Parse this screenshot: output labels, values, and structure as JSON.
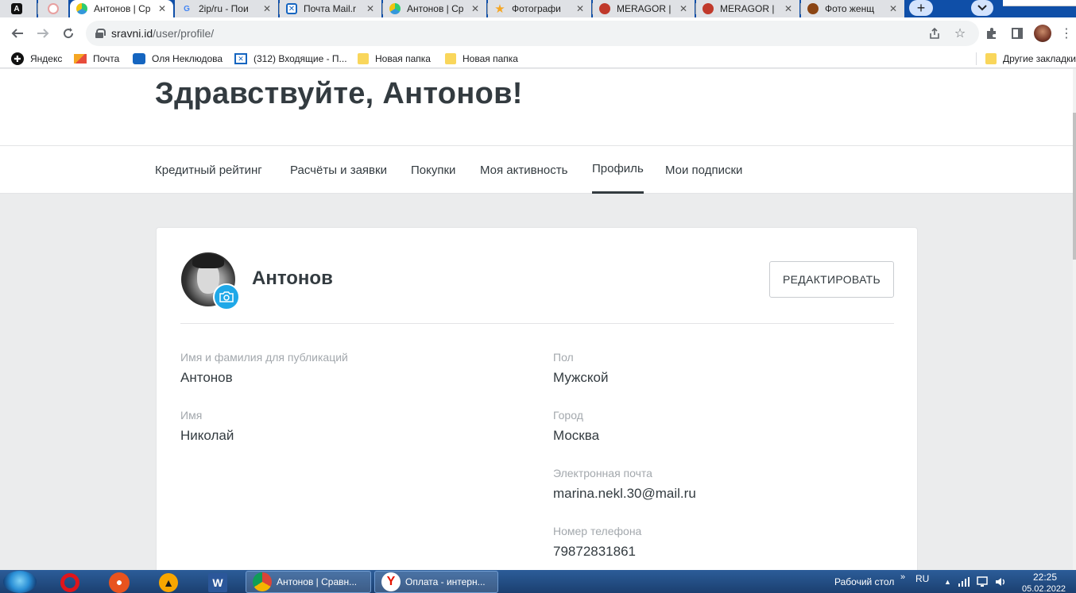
{
  "browser": {
    "tabs": [
      {
        "title": "",
        "icon": "A-logo-icon",
        "state": "inactive"
      },
      {
        "title": "",
        "icon": "red-circle-icon",
        "state": "inactive"
      },
      {
        "title": "Антонов | Ср",
        "icon": "sravni-icon",
        "state": "active"
      },
      {
        "title": "2ip/ru - Пои",
        "icon": "google-icon",
        "state": "inactive"
      },
      {
        "title": "Почта Mail.r",
        "icon": "mail-icon",
        "state": "inactive"
      },
      {
        "title": "Антонов | Ср",
        "icon": "sravni-icon",
        "state": "inactive"
      },
      {
        "title": "Фотографи",
        "icon": "star-icon",
        "state": "inactive"
      },
      {
        "title": "MERAGOR |",
        "icon": "meragor-icon",
        "state": "inactive"
      },
      {
        "title": "MERAGOR |",
        "icon": "meragor-icon",
        "state": "inactive"
      },
      {
        "title": "Фото женщ",
        "icon": "dog-icon",
        "state": "inactive"
      }
    ],
    "new_tab_label": "+",
    "url_domain": "sravni.id",
    "url_path": "/user/profile/",
    "bookmarks": [
      {
        "label": "Яндекс",
        "icon": "yandex-icon"
      },
      {
        "label": "Почта",
        "icon": "mail-envelope-icon"
      },
      {
        "label": "Оля Неклюдова",
        "icon": "chat-icon"
      },
      {
        "label": "(312) Входящие - П...",
        "icon": "mail-icon"
      },
      {
        "label": "Новая папка",
        "icon": "folder-icon"
      },
      {
        "label": "Новая папка",
        "icon": "folder-icon"
      }
    ],
    "other_bookmarks": "Другие закладки"
  },
  "page": {
    "greeting": "Здравствуйте, Антонов!",
    "nav": [
      {
        "label": "Кредитный рейтинг",
        "selected": false
      },
      {
        "label": "Расчёты и заявки",
        "selected": false
      },
      {
        "label": "Покупки",
        "selected": false
      },
      {
        "label": "Моя активность",
        "selected": false
      },
      {
        "label": "Профиль",
        "selected": true
      },
      {
        "label": "Мои подписки",
        "selected": false
      }
    ],
    "profile": {
      "name": "Антонов",
      "edit_button": "РЕДАКТИРОВАТЬ",
      "fields_left": [
        {
          "label": "Имя и фамилия для публикаций",
          "value": "Антонов"
        },
        {
          "label": "Имя",
          "value": "Николай"
        }
      ],
      "fields_right": [
        {
          "label": "Пол",
          "value": "Мужской"
        },
        {
          "label": "Город",
          "value": "Москва"
        },
        {
          "label": "Электронная почта",
          "value": "marina.nekl.30@mail.ru"
        },
        {
          "label": "Номер телефона",
          "value": "79872831861"
        }
      ]
    },
    "accent_color": "#1fa8e8"
  },
  "taskbar": {
    "tasks": [
      {
        "label": "Антонов | Сравн...",
        "icon": "chrome-icon"
      },
      {
        "label": "Оплата - интерн...",
        "icon": "yandex-browser-icon"
      }
    ],
    "desktop_label": "Рабочий стол",
    "lang": "RU",
    "time": "22:25",
    "date": "05.02.2022"
  }
}
